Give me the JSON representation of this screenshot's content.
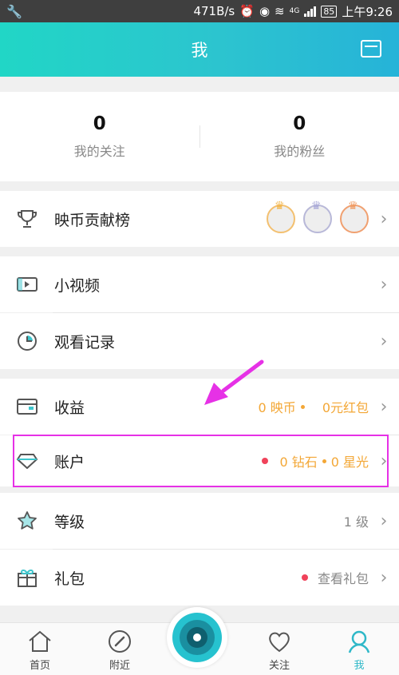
{
  "status_bar": {
    "speed": "471B/s",
    "network": "4G",
    "battery": "85",
    "time": "上午9:26"
  },
  "header": {
    "title": "我"
  },
  "stats": [
    {
      "count": "0",
      "label": "我的关注"
    },
    {
      "count": "0",
      "label": "我的粉丝"
    }
  ],
  "rows": {
    "ranking": {
      "label": "映币贡献榜"
    },
    "video": {
      "label": "小视频"
    },
    "history": {
      "label": "观看记录"
    },
    "earnings": {
      "label": "收益",
      "coins": "0 映币",
      "red_packet": "0元红包"
    },
    "account": {
      "label": "账户",
      "diamonds": "0 钻石",
      "stars": "0 星光"
    },
    "level": {
      "label": "等级",
      "value": "1 级"
    },
    "gift": {
      "label": "礼包",
      "value": "查看礼包"
    }
  },
  "bottom_nav": [
    {
      "label": "首页",
      "icon": "home-icon"
    },
    {
      "label": "附近",
      "icon": "compass-icon"
    },
    {
      "label": "",
      "icon": "camera-button-icon"
    },
    {
      "label": "关注",
      "icon": "heart-icon"
    },
    {
      "label": "我",
      "icon": "profile-icon"
    }
  ],
  "colors": {
    "accent": "#2cc4cf",
    "value_orange": "#f3a736",
    "badge_red": "#f0425a",
    "annotation_magenta": "#e631e6"
  }
}
